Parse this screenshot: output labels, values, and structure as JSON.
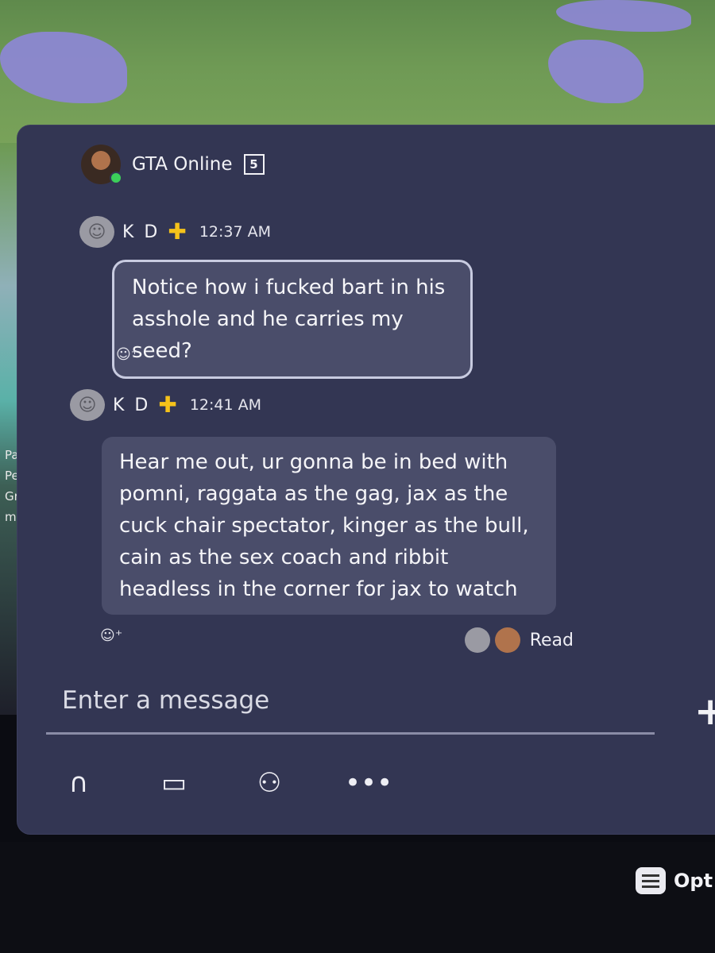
{
  "background": {
    "side_names": [
      "PaidT",
      "Penit",
      "Grost",
      "mace"
    ]
  },
  "header": {
    "group_title": "GTA Online",
    "member_count": "5"
  },
  "messages": [
    {
      "username": "K D",
      "time": "12:37 AM",
      "text": "Notice how i fucked bart in his asshole and he carries my seed?"
    },
    {
      "username": "K D",
      "time": "12:41 AM",
      "text": "Hear me out, ur gonna be in bed with pomni, raggata as the gag, jax as the cuck chair spectator, kinger as the bull, cain as the sex coach and ribbit headless in the corner for jax to watch"
    }
  ],
  "read_receipt": {
    "label": "Read"
  },
  "composer": {
    "placeholder": "Enter a message"
  },
  "toolbar": {
    "icons": [
      "headset-icon",
      "share-screen-icon",
      "party-members-icon",
      "more-icon"
    ]
  },
  "footer": {
    "options_label": "Opt"
  },
  "colors": {
    "panel": "#333653",
    "bubble": "#4a4d6a",
    "ps_plus": "#f5c21a",
    "online": "#3ccf5a"
  }
}
